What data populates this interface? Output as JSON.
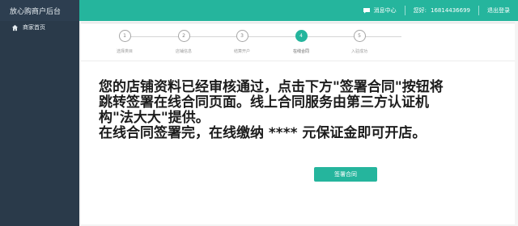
{
  "header": {
    "brand": "放心购商户后台",
    "message_center": "消息中心",
    "greeting": "您好:",
    "account": "16814436699",
    "logout": "退出登录"
  },
  "sidebar": {
    "items": [
      {
        "label": "商家首页",
        "icon": "home-icon"
      }
    ]
  },
  "steps": [
    {
      "number": "1",
      "label": "选择类目",
      "active": false
    },
    {
      "number": "2",
      "label": "店铺信息",
      "active": false
    },
    {
      "number": "3",
      "label": "结算开户",
      "active": false
    },
    {
      "number": "4",
      "label": "在线合同",
      "active": true
    },
    {
      "number": "5",
      "label": "入驻成功",
      "active": false
    }
  ],
  "message": {
    "line1": "您的店铺资料已经审核通过，点击下方\"签署合同\"按钮将",
    "line2": "跳转签署在线合同页面。线上合同服务由第三方认证机",
    "line3": "构\"法大大\"提供。",
    "line4": "在线合同签署完，在线缴纳  ****  元保证金即可开店。"
  },
  "sign_button": "签署合同",
  "colors": {
    "accent": "#25b59d",
    "sidebar": "#2a3a4a",
    "brand_bar": "#2d3e50"
  }
}
